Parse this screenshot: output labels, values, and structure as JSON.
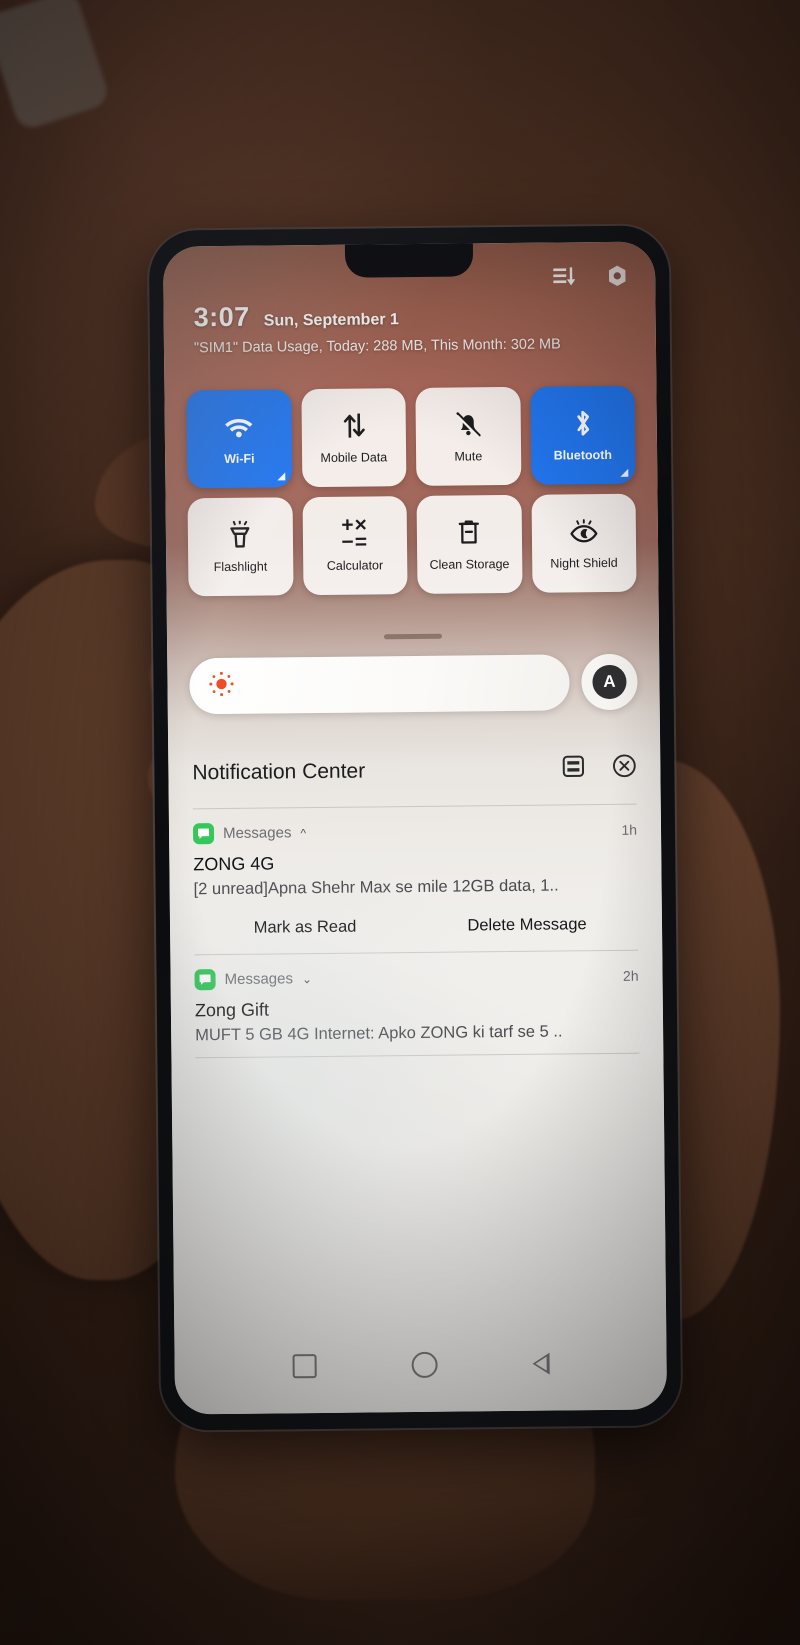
{
  "scene": {
    "description": "hand-held smartphone photo",
    "background_color": "#3a2318"
  },
  "statusbar": {
    "clock": "3:07",
    "date": "Sun, September 1",
    "data_usage": "\"SIM1\" Data Usage, Today: 288 MB, This Month: 302 MB",
    "icons": [
      {
        "name": "sort-filter-icon"
      },
      {
        "name": "settings-gear-icon"
      }
    ]
  },
  "quick_settings": {
    "active_color": "#2276ef",
    "rows": [
      [
        {
          "label": "Wi-Fi",
          "icon": "wifi-icon",
          "active": true,
          "has_corner": true
        },
        {
          "label": "Mobile Data",
          "icon": "mobile-data-icon",
          "active": false,
          "has_corner": false
        },
        {
          "label": "Mute",
          "icon": "bell-mute-icon",
          "active": false,
          "has_corner": false
        },
        {
          "label": "Bluetooth",
          "icon": "bluetooth-icon",
          "active": true,
          "has_corner": true
        }
      ],
      [
        {
          "label": "Flashlight",
          "icon": "flashlight-icon",
          "active": false,
          "has_corner": false
        },
        {
          "label": "Calculator",
          "icon": "calculator-icon",
          "active": false,
          "has_corner": false
        },
        {
          "label": "Clean Storage",
          "icon": "trash-clean-icon",
          "active": false,
          "has_corner": false
        },
        {
          "label": "Night Shield",
          "icon": "night-shield-eye-icon",
          "active": false,
          "has_corner": false
        }
      ]
    ]
  },
  "brightness": {
    "slider_icon": "brightness-sun-icon",
    "sun_color": "#f04a22",
    "auto_label": "A"
  },
  "notification_center": {
    "title": "Notification Center",
    "actions": [
      {
        "name": "notification-settings-icon"
      },
      {
        "name": "clear-all-icon"
      }
    ],
    "notifications": [
      {
        "app": "Messages",
        "app_icon": "messages-bubble-icon",
        "chevron": "chevron-up-icon",
        "expanded": true,
        "time": "1h",
        "title": "ZONG 4G",
        "body": "[2 unread]Apna Shehr Max se mile 12GB data, 1..",
        "actions": [
          "Mark as Read",
          "Delete Message"
        ]
      },
      {
        "app": "Messages",
        "app_icon": "messages-bubble-icon",
        "chevron": "chevron-down-icon",
        "expanded": false,
        "time": "2h",
        "title": "Zong Gift",
        "body": "MUFT 5 GB 4G Internet: Apko ZONG ki tarf se 5 ..",
        "actions": []
      }
    ]
  },
  "navbar": {
    "items": [
      {
        "name": "recents-square-button"
      },
      {
        "name": "home-circle-button"
      },
      {
        "name": "back-triangle-button"
      }
    ]
  }
}
